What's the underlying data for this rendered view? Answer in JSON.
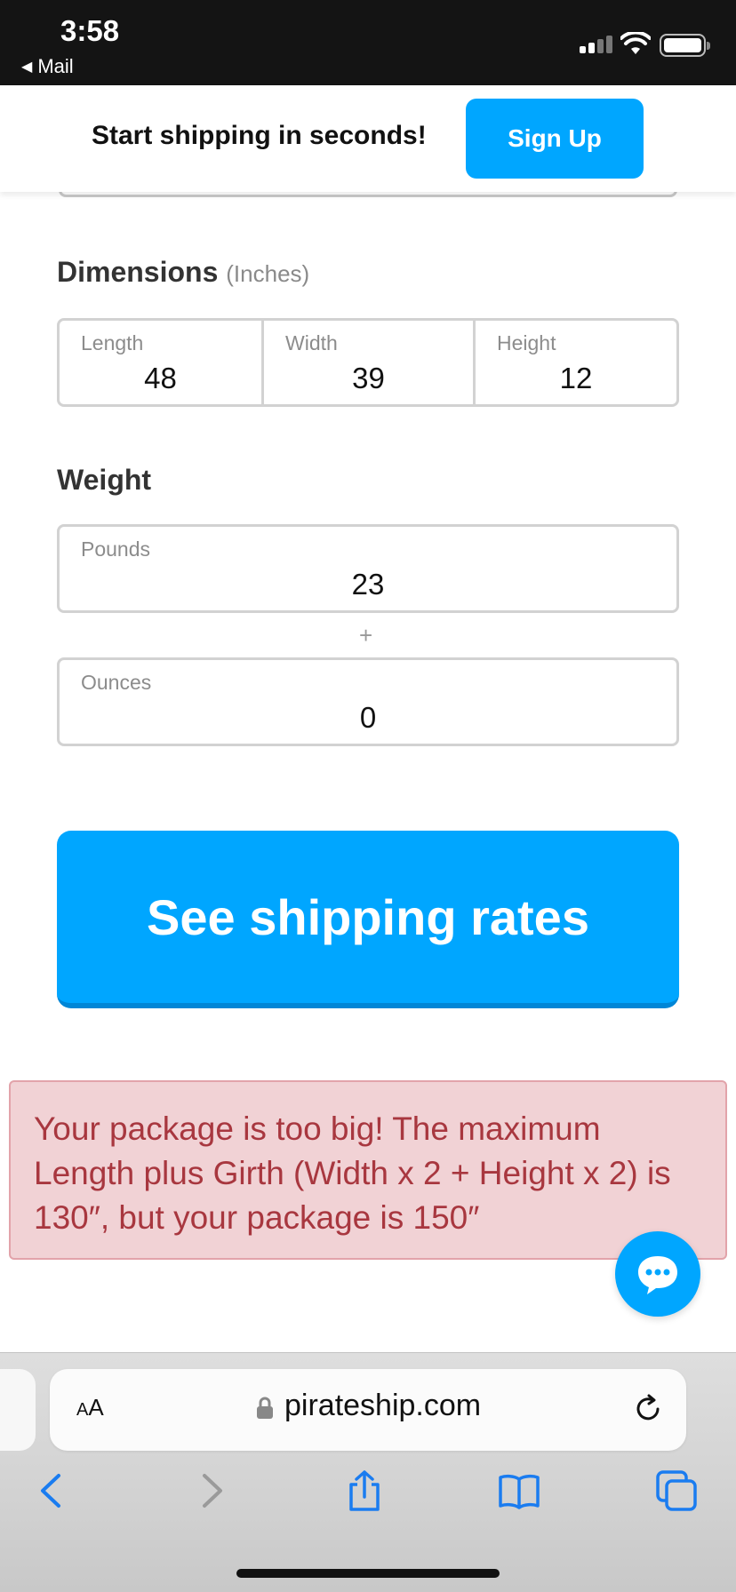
{
  "status_bar": {
    "time": "3:58",
    "back_app": "Mail"
  },
  "header": {
    "tagline": "Start shipping in seconds!",
    "signup_label": "Sign Up"
  },
  "dimensions": {
    "title": "Dimensions",
    "unit": "(Inches)",
    "fields": [
      {
        "label": "Length",
        "value": "48"
      },
      {
        "label": "Width",
        "value": "39"
      },
      {
        "label": "Height",
        "value": "12"
      }
    ]
  },
  "weight": {
    "title": "Weight",
    "pounds_label": "Pounds",
    "pounds_value": "23",
    "plus": "+",
    "ounces_label": "Ounces",
    "ounces_value": "0"
  },
  "rates_button_label": "See shipping rates",
  "error": {
    "message": "Your package is too big! The maximum Length plus Girth (Width x 2 + Height x 2) is 130″, but your package is 150″"
  },
  "browser": {
    "text_size_label_big": "A",
    "text_size_label_small": "A",
    "url": "pirateship.com"
  },
  "colors": {
    "accent": "#00a6ff",
    "error_bg": "#f1d2d5",
    "error_text": "#a8373f"
  },
  "icons": [
    "chevron-left-icon",
    "chevron-right-icon",
    "share-icon",
    "bookmarks-icon",
    "tabs-icon",
    "lock-icon",
    "reload-icon",
    "chat-icon"
  ]
}
